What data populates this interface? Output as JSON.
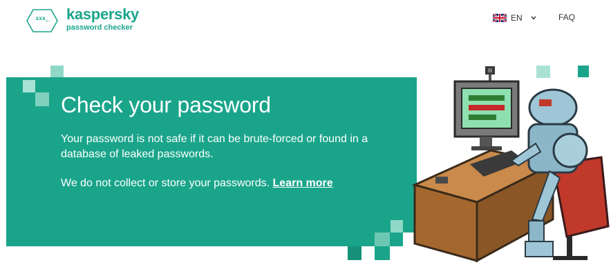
{
  "header": {
    "logo_badge": "xxx_",
    "brand": "kaspersky",
    "product": "password checker",
    "language": "EN",
    "faq": "FAQ"
  },
  "hero": {
    "title": "Check your password",
    "description": "Your password is not safe if it can be brute-forced or found in a database of leaked passwords.",
    "privacy_text": "We do not collect or store your passwords.",
    "learn_more": "Learn more"
  },
  "icons": [
    "kaspersky-logo-badge",
    "uk-flag-icon",
    "chevron-down-icon",
    "robot-hacker-illustration"
  ],
  "colors": {
    "brand": "#1aa58b",
    "hero_bg": "#1aa58b",
    "hero_text": "#ffffff",
    "nav_text": "#333333"
  }
}
